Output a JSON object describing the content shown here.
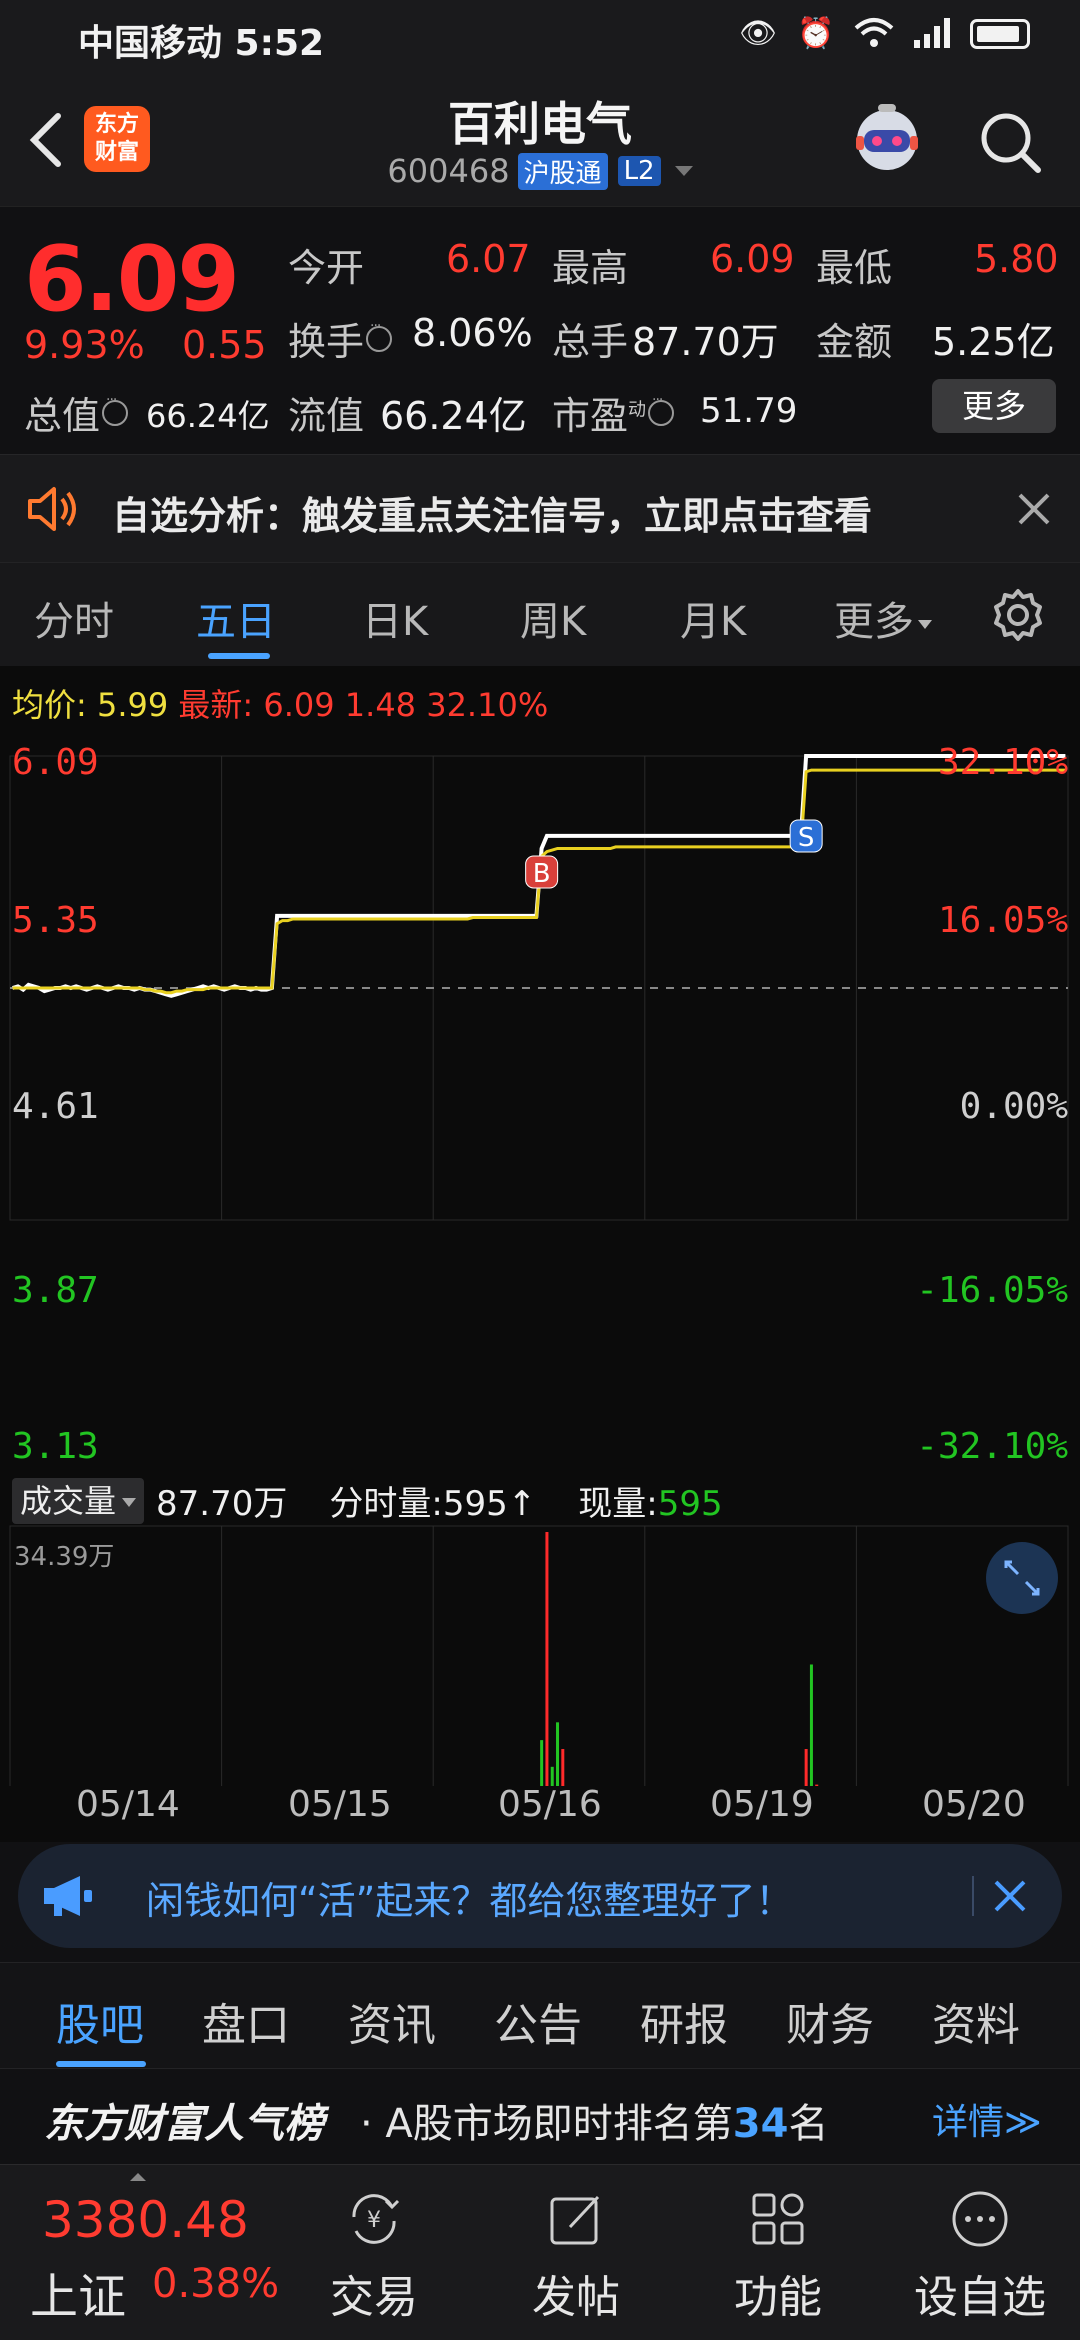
{
  "status_bar": {
    "carrier_time": "中国移动 5:52"
  },
  "header": {
    "logo_line1": "东方",
    "logo_line2": "财富",
    "stock_name": "百利电气",
    "stock_code": "600468",
    "tag_connect": "沪股通",
    "tag_level": "L2"
  },
  "quote": {
    "price": "6.09",
    "change_pct": "9.93%",
    "change_abs": "0.55",
    "open_label": "今开",
    "open_value": "6.07",
    "high_label": "最高",
    "high_value": "6.09",
    "low_label": "最低",
    "low_value": "5.80",
    "turnover_label": "换手",
    "turnover_value": "8.06%",
    "volume_label": "总手",
    "volume_value": "87.70万",
    "amount_label": "金额",
    "amount_value": "5.25亿",
    "mcap_label": "总值",
    "mcap_value": "66.24亿",
    "float_label": "流值",
    "float_value": "66.24亿",
    "pe_label": "市盈",
    "pe_sup": "动",
    "pe_value": "51.79",
    "more_button": "更多"
  },
  "banner1": {
    "text": "自选分析：触发重点关注信号，立即点击查看"
  },
  "tabs": [
    {
      "label": "分时"
    },
    {
      "label": "五日"
    },
    {
      "label": "日K"
    },
    {
      "label": "周K"
    },
    {
      "label": "月K"
    },
    {
      "label": "更多"
    }
  ],
  "legend": {
    "avg_label": "均价:",
    "avg_value": "5.99",
    "latest_label": "最新:",
    "latest_value": "6.09",
    "latest_change": "1.48",
    "latest_pct": "32.10%"
  },
  "chart_data": {
    "type": "line",
    "y_price_ticks": [
      "6.09",
      "5.35",
      "4.61",
      "3.87",
      "3.13"
    ],
    "y_pct_ticks": [
      "32.10%",
      "16.05%",
      "0.00%",
      "-16.05%",
      "-32.10%"
    ],
    "ylim": [
      3.13,
      6.09
    ],
    "reference": 4.61,
    "x_labels": [
      "05/14",
      "05/15",
      "05/16",
      "05/19",
      "05/20"
    ],
    "series": [
      {
        "values": [
          4.61,
          4.62,
          4.6,
          4.63,
          4.62,
          4.61,
          4.59,
          4.6,
          4.61,
          4.61,
          4.62,
          4.61,
          4.62,
          4.61,
          4.6,
          4.61,
          4.62,
          4.61,
          4.6,
          4.61,
          4.62,
          4.61,
          4.61,
          4.6,
          4.61,
          4.6,
          4.6,
          4.59,
          4.58,
          4.57,
          4.56,
          4.57,
          4.58,
          4.59,
          4.6,
          4.61,
          4.62,
          4.61,
          4.62,
          4.61,
          4.6,
          4.61,
          4.62,
          4.61,
          4.61,
          4.6,
          4.61,
          4.6,
          4.6,
          4.61,
          5.07,
          5.07,
          5.07,
          5.07,
          5.07,
          5.07,
          5.07,
          5.07,
          5.07,
          5.07,
          5.07,
          5.07,
          5.07,
          5.07,
          5.07,
          5.07,
          5.07,
          5.07,
          5.07,
          5.07,
          5.07,
          5.07,
          5.07,
          5.07,
          5.07,
          5.07,
          5.07,
          5.07,
          5.07,
          5.07,
          5.07,
          5.07,
          5.07,
          5.07,
          5.07,
          5.07,
          5.07,
          5.07,
          5.07,
          5.07,
          5.07,
          5.07,
          5.07,
          5.07,
          5.07,
          5.07,
          5.07,
          5.07,
          5.07,
          5.07,
          5.5,
          5.58,
          5.58,
          5.58,
          5.58,
          5.58,
          5.58,
          5.58,
          5.58,
          5.58,
          5.58,
          5.58,
          5.58,
          5.58,
          5.58,
          5.58,
          5.58,
          5.58,
          5.58,
          5.58,
          5.58,
          5.58,
          5.58,
          5.58,
          5.58,
          5.58,
          5.58,
          5.58,
          5.58,
          5.58,
          5.58,
          5.58,
          5.58,
          5.58,
          5.58,
          5.58,
          5.58,
          5.58,
          5.58,
          5.58,
          5.58,
          5.58,
          5.58,
          5.58,
          5.58,
          5.58,
          5.58,
          5.58,
          5.58,
          5.58,
          6.09,
          6.09,
          6.09,
          6.09,
          6.09,
          6.09,
          6.09,
          6.09,
          6.09,
          6.09,
          6.09,
          6.09,
          6.09,
          6.09,
          6.09,
          6.09,
          6.09,
          6.09,
          6.09,
          6.09,
          6.09,
          6.09,
          6.09,
          6.09,
          6.09,
          6.09,
          6.09,
          6.09,
          6.09,
          6.09,
          6.09,
          6.09,
          6.09,
          6.09,
          6.09,
          6.09,
          6.09,
          6.09,
          6.09,
          6.09,
          6.09,
          6.09,
          6.09,
          6.09,
          6.09,
          6.09,
          6.09,
          6.09,
          6.09,
          6.09
        ],
        "color": "#ffffff"
      },
      {
        "values": [
          4.61,
          4.61,
          4.61,
          4.61,
          4.61,
          4.61,
          4.61,
          4.61,
          4.61,
          4.61,
          4.61,
          4.61,
          4.61,
          4.61,
          4.61,
          4.61,
          4.61,
          4.61,
          4.61,
          4.61,
          4.61,
          4.61,
          4.61,
          4.61,
          4.61,
          4.6,
          4.6,
          4.59,
          4.59,
          4.58,
          4.58,
          4.59,
          4.59,
          4.6,
          4.6,
          4.6,
          4.6,
          4.61,
          4.61,
          4.61,
          4.61,
          4.61,
          4.61,
          4.61,
          4.61,
          4.61,
          4.61,
          4.61,
          4.61,
          4.61,
          5.02,
          5.04,
          5.04,
          5.05,
          5.05,
          5.05,
          5.05,
          5.05,
          5.05,
          5.05,
          5.05,
          5.05,
          5.05,
          5.05,
          5.05,
          5.05,
          5.05,
          5.05,
          5.05,
          5.05,
          5.05,
          5.05,
          5.05,
          5.05,
          5.05,
          5.05,
          5.05,
          5.05,
          5.05,
          5.05,
          5.05,
          5.05,
          5.05,
          5.05,
          5.05,
          5.05,
          5.05,
          5.06,
          5.06,
          5.06,
          5.06,
          5.06,
          5.06,
          5.06,
          5.06,
          5.06,
          5.06,
          5.06,
          5.06,
          5.06,
          5.45,
          5.48,
          5.49,
          5.5,
          5.5,
          5.5,
          5.5,
          5.5,
          5.5,
          5.5,
          5.5,
          5.5,
          5.5,
          5.5,
          5.51,
          5.51,
          5.51,
          5.51,
          5.51,
          5.51,
          5.51,
          5.51,
          5.51,
          5.51,
          5.51,
          5.51,
          5.51,
          5.51,
          5.51,
          5.51,
          5.51,
          5.51,
          5.51,
          5.51,
          5.51,
          5.51,
          5.51,
          5.51,
          5.51,
          5.51,
          5.51,
          5.51,
          5.51,
          5.51,
          5.51,
          5.51,
          5.51,
          5.51,
          5.51,
          5.51,
          5.99,
          6.0,
          6.0,
          6.0,
          6.0,
          6.0,
          6.0,
          6.0,
          6.0,
          6.0,
          6.0,
          6.0,
          6.0,
          6.0,
          6.0,
          6.0,
          6.0,
          6.0,
          6.0,
          6.0,
          6.0,
          6.0,
          6.0,
          6.0,
          6.0,
          6.0,
          6.0,
          6.0,
          6.0,
          6.0,
          6.0,
          6.0,
          6.0,
          6.0,
          6.0,
          6.0,
          6.0,
          6.0,
          6.0,
          6.0,
          6.0,
          6.0,
          6.0,
          6.0,
          6.0,
          6.0,
          6.0,
          6.0,
          6.0,
          6.0
        ],
        "color": "#e8d020"
      }
    ],
    "markers": [
      {
        "label": "B",
        "index": 100,
        "price": 5.35,
        "color": "#d9403a"
      },
      {
        "label": "S",
        "index": 150,
        "price": 5.58,
        "color": "#2b6fd6"
      }
    ]
  },
  "volume": {
    "select_label": "成交量",
    "total": "87.70万",
    "tick_label": "分时量:595",
    "current_label": "现量:",
    "current_value": "595",
    "max_label": "34.39万",
    "max": 34.39,
    "bars": [
      {
        "i": 0,
        "v": 0.1,
        "c": "red"
      },
      {
        "i": 20,
        "v": 0.3,
        "c": "green"
      },
      {
        "i": 50,
        "v": 3.4,
        "c": "red"
      },
      {
        "i": 51,
        "v": 1.2,
        "c": "red"
      },
      {
        "i": 52,
        "v": 0.5,
        "c": "green"
      },
      {
        "i": 76,
        "v": 3.2,
        "c": "red"
      },
      {
        "i": 89,
        "v": 2.0,
        "c": "red"
      },
      {
        "i": 100,
        "v": 11.0,
        "c": "green"
      },
      {
        "i": 101,
        "v": 34.39,
        "c": "red"
      },
      {
        "i": 102,
        "v": 8.0,
        "c": "green"
      },
      {
        "i": 103,
        "v": 13.0,
        "c": "green"
      },
      {
        "i": 104,
        "v": 10.0,
        "c": "red"
      },
      {
        "i": 105,
        "v": 5.0,
        "c": "green"
      },
      {
        "i": 106,
        "v": 3.0,
        "c": "red"
      },
      {
        "i": 150,
        "v": 10.0,
        "c": "red"
      },
      {
        "i": 151,
        "v": 19.5,
        "c": "green"
      },
      {
        "i": 152,
        "v": 6.0,
        "c": "red"
      },
      {
        "i": 153,
        "v": 2.0,
        "c": "green"
      }
    ]
  },
  "banner2": {
    "text": "闲钱如何“活”起来？都给您整理好了！"
  },
  "bottom_tabs": [
    {
      "label": "股吧"
    },
    {
      "label": "盘口"
    },
    {
      "label": "资讯"
    },
    {
      "label": "公告"
    },
    {
      "label": "研报"
    },
    {
      "label": "财务"
    },
    {
      "label": "资料"
    }
  ],
  "rank": {
    "brand": "东方财富人气榜",
    "text_pre": "· A股市场即时排名第",
    "number": "34",
    "text_post": "名",
    "detail": "详情≫"
  },
  "bottom_nav": {
    "index_value": "3380.48",
    "index_name": "上证",
    "index_change": "0.38%",
    "items": [
      {
        "label": "交易",
        "icon": "trade-icon"
      },
      {
        "label": "发帖",
        "icon": "post-icon"
      },
      {
        "label": "功能",
        "icon": "function-icon"
      },
      {
        "label": "设自选",
        "icon": "favorite-icon"
      }
    ]
  }
}
